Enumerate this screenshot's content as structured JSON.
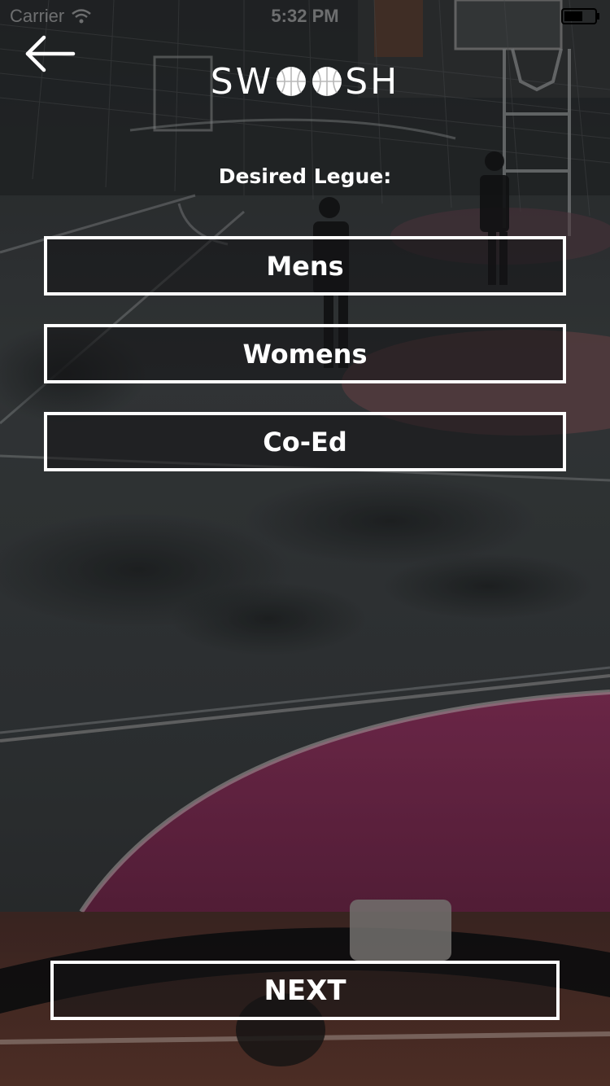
{
  "status_bar": {
    "carrier": "Carrier",
    "time": "5:32 PM",
    "wifi_icon": "wifi-icon",
    "battery_icon": "battery-icon"
  },
  "nav": {
    "back_icon": "arrow-left-icon"
  },
  "logo": {
    "prefix": "SW",
    "suffix": "SH",
    "ball_icon": "basketball-icon"
  },
  "prompt": {
    "label": "Desired Legue:"
  },
  "options": [
    {
      "label": "Mens"
    },
    {
      "label": "Womens"
    },
    {
      "label": "Co-Ed"
    }
  ],
  "next_button": {
    "label": "NEXT"
  },
  "colors": {
    "text": "#ffffff",
    "button_border": "#ffffff",
    "court_pink": "#8a2a55",
    "court_gray": "#3a3d3f"
  }
}
